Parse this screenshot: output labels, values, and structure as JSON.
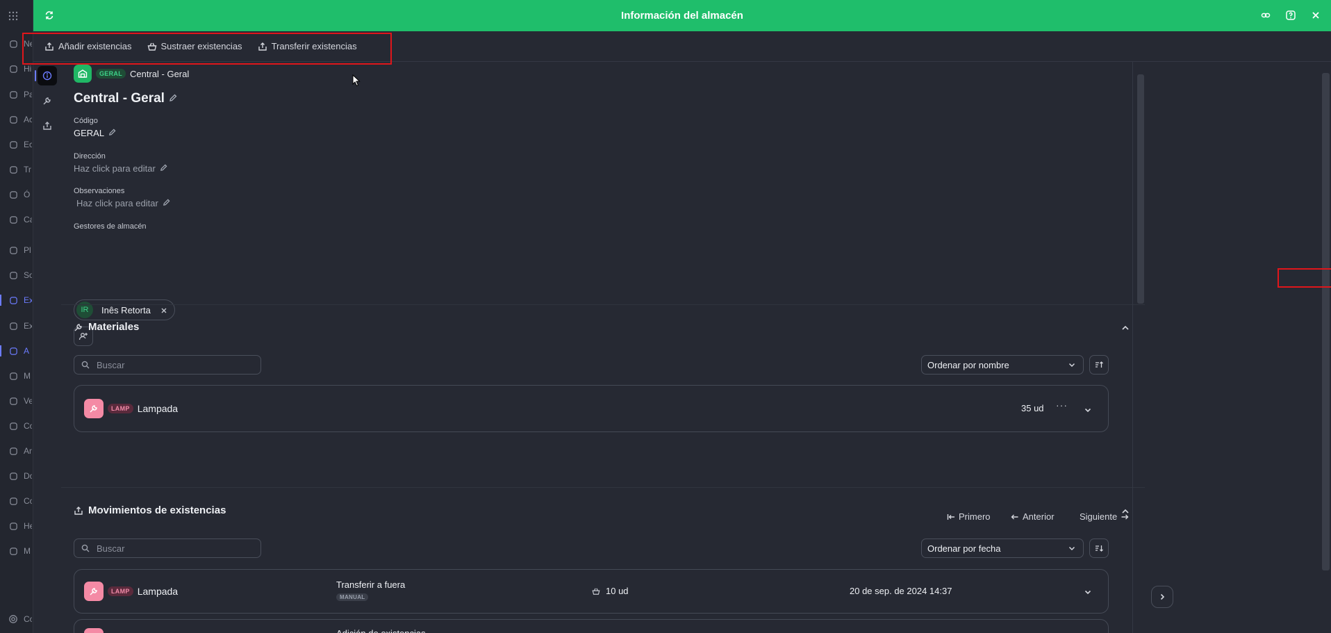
{
  "background_sidebar": {
    "items": [
      {
        "label": "Ne",
        "icon": "globe-icon"
      },
      {
        "label": "Hi",
        "icon": "compass-icon"
      },
      {
        "label": "Pa",
        "icon": "grid-icon"
      },
      {
        "label": "Ac",
        "icon": "chart-icon"
      },
      {
        "label": "Ec",
        "icon": "home-icon"
      },
      {
        "label": "Tr",
        "icon": "calendar-icon"
      },
      {
        "label": "Ó",
        "icon": "clipboard-icon"
      },
      {
        "label": "Ca",
        "icon": "calendar-icon"
      },
      {
        "label": "Pl",
        "icon": "calendar-icon"
      },
      {
        "label": "So",
        "icon": "bell-icon"
      },
      {
        "label": "Ex",
        "icon": "stack-icon",
        "active": true
      },
      {
        "label": "Ex",
        "icon": "stack-icon"
      },
      {
        "label": "A",
        "icon": "warehouse-icon",
        "active": true
      },
      {
        "label": "M",
        "icon": "wrench-icon"
      },
      {
        "label": "Ve",
        "icon": "tag-icon"
      },
      {
        "label": "Co",
        "icon": "cart-icon"
      },
      {
        "label": "An",
        "icon": "bar-chart-icon"
      },
      {
        "label": "Do",
        "icon": "document-icon"
      },
      {
        "label": "Co",
        "icon": "bolt-icon"
      },
      {
        "label": "He",
        "icon": "tools-icon"
      },
      {
        "label": "M",
        "icon": "location-icon"
      },
      {
        "label": "Co",
        "icon": "settings-icon"
      }
    ]
  },
  "modal": {
    "title": "Información del almacén",
    "toolbar": {
      "add_stock": "Añadir existencias",
      "subtract_stock": "Sustraer existencias",
      "transfer_stock": "Transferir existencias"
    }
  },
  "warehouse": {
    "code_badge": "GERAL",
    "chip_name": "Central - Geral",
    "name": "Central - Geral",
    "code_label": "Código",
    "code_value": "GERAL",
    "address_label": "Dirección",
    "address_placeholder": "Haz click para editar",
    "notes_label": "Observaciones",
    "notes_placeholder": "Haz click para editar",
    "managers_label": "Gestores de almacén",
    "managers": [
      {
        "initials": "IR",
        "name": "Inês Retorta"
      }
    ]
  },
  "materials": {
    "title": "Materiales",
    "search_placeholder": "Buscar",
    "sort_value": "Ordenar por nombre",
    "items": [
      {
        "badge": "LAMP",
        "name": "Lampada",
        "qty": "35 ud"
      }
    ],
    "pager": {
      "first": "Primero",
      "prev": "Anterior",
      "next": "Siguiente"
    }
  },
  "movements": {
    "title": "Movimientos de existencias",
    "search_placeholder": "Buscar",
    "sort_value": "Ordenar por fecha",
    "items": [
      {
        "badge": "LAMP",
        "name": "Lampada",
        "type": "Transferir a fuera",
        "type_badge": "MANUAL",
        "qty": "10 ud",
        "date": "20 de sep. de 2024 14:37"
      },
      {
        "type": "Adición de existencias"
      }
    ]
  },
  "colors": {
    "header_green": "#1fbe6b",
    "accent": "#6c7cff",
    "background": "#262933",
    "annotation_red": "#e0161b"
  }
}
